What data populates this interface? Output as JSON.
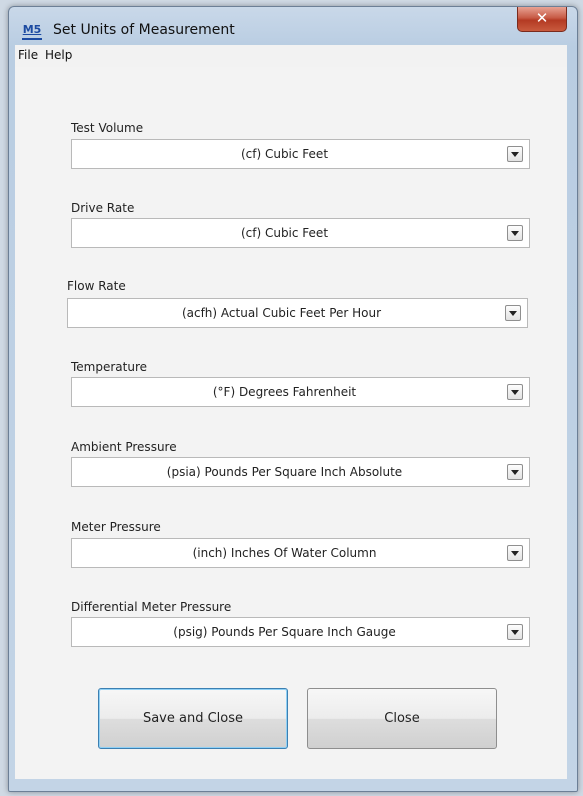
{
  "window": {
    "icon_text": "M5",
    "title": "Set Units of Measurement",
    "close_glyph": "✕"
  },
  "menu": {
    "file": "File",
    "help": "Help"
  },
  "fields": {
    "test_volume": {
      "label": "Test Volume",
      "value": "(cf) Cubic Feet"
    },
    "drive_rate": {
      "label": "Drive Rate",
      "value": "(cf) Cubic Feet"
    },
    "flow_rate": {
      "label": "Flow Rate",
      "value": "(acfh) Actual Cubic Feet Per Hour"
    },
    "temperature": {
      "label": "Temperature",
      "value": "(°F) Degrees Fahrenheit"
    },
    "ambient_pressure": {
      "label": "Ambient Pressure",
      "value": "(psia) Pounds Per Square Inch  Absolute"
    },
    "meter_pressure": {
      "label": "Meter Pressure",
      "value": "(inch) Inches Of Water Column"
    },
    "differential_meter_pressure": {
      "label": "Differential Meter Pressure",
      "value": "(psig) Pounds Per Square Inch  Gauge"
    }
  },
  "buttons": {
    "save_and_close": "Save and Close",
    "close": "Close"
  },
  "icons": {
    "app": "app-icon",
    "close": "close-icon",
    "dropdown": "chevron-down-icon"
  }
}
